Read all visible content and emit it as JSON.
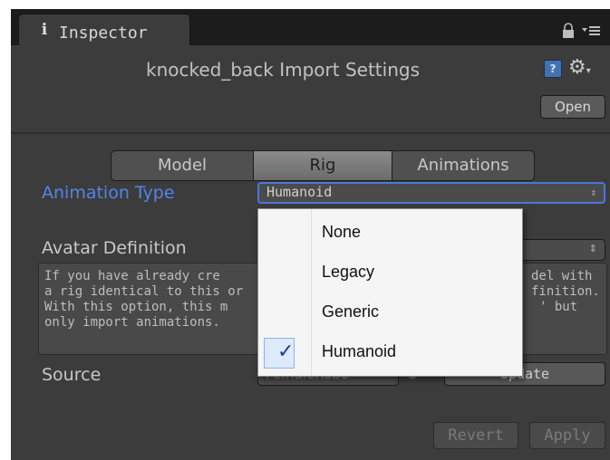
{
  "inspector": {
    "tab_label": "Inspector",
    "tab_icon": "info-icon",
    "title": "knocked_back Import Settings",
    "open_label": "Open"
  },
  "tabs": [
    {
      "label": "Model",
      "active": false
    },
    {
      "label": "Rig",
      "active": true
    },
    {
      "label": "Animations",
      "active": false
    }
  ],
  "rig": {
    "animation_type_label": "Animation Type",
    "animation_type_value": "Humanoid",
    "avatar_definition_label": "Avatar Definition",
    "help_text_lines": [
      "If you have already cre",
      "a rig identical to this or",
      "With this option, this m",
      "only import animations."
    ],
    "help_text_lines_right": [
      "del with",
      "finition.",
      "' but",
      ""
    ],
    "source_label": "Source",
    "source_value": "FemaleRobo",
    "update_label": "Update"
  },
  "footer": {
    "revert_label": "Revert",
    "apply_label": "Apply"
  },
  "dropdown": {
    "options": [
      {
        "label": "None",
        "checked": false
      },
      {
        "label": "Legacy",
        "checked": false
      },
      {
        "label": "Generic",
        "checked": false
      },
      {
        "label": "Humanoid",
        "checked": true
      }
    ],
    "check_glyph": "✓"
  },
  "colors": {
    "panel_bg": "#3c3c3c",
    "accent_blue": "#5087e8",
    "dropdown_bg": "#f5f5f5"
  }
}
